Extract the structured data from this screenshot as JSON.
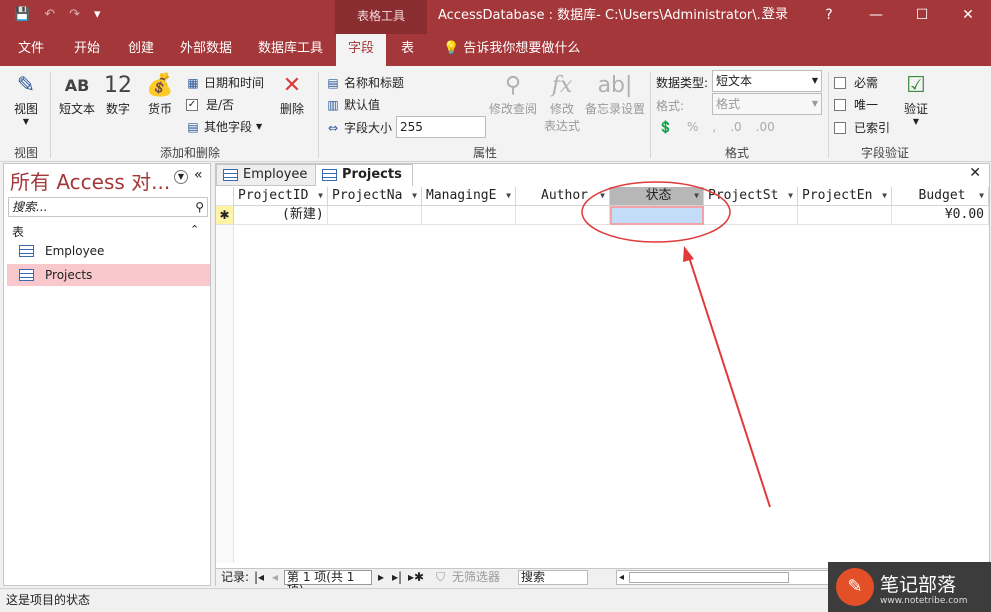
{
  "titlebar": {
    "qat": [
      "💾",
      "↶",
      "↷",
      "▾"
    ],
    "context_tools": "表格工具",
    "title": "AccessDatabase : 数据库- C:\\Users\\Administrator\\...",
    "login": "登录",
    "help": "?",
    "minimize": "—",
    "maximize": "☐",
    "close": "✕"
  },
  "tabs": {
    "file": "文件",
    "home": "开始",
    "create": "创建",
    "external": "外部数据",
    "dbtools": "数据库工具",
    "fields": "字段",
    "table": "表",
    "tellme": "告诉我你想要做什么"
  },
  "ribbon": {
    "view": "视图",
    "view_group": "视图",
    "short_text_icon": "AB",
    "short_text": "短文本",
    "number_icon": "12",
    "number": "数字",
    "currency": "货币",
    "datetime": "日期和时间",
    "yesno": "是/否",
    "more_fields": "其他字段",
    "delete": "删除",
    "add_delete_group": "添加和删除",
    "name_caption": "名称和标题",
    "default_value": "默认值",
    "field_size": "字段大小",
    "field_size_value": "255",
    "modify_lookups": "修改查阅",
    "modify_expr_1": "修改",
    "modify_expr_2": "表达式",
    "memo_settings": "备忘录设置",
    "properties_group": "属性",
    "data_type_label": "数据类型:",
    "data_type_value": "短文本",
    "format_label": "格式:",
    "format_value": "格式",
    "format_group": "格式",
    "required": "必需",
    "unique": "唯一",
    "indexed": "已索引",
    "validation": "验证",
    "validation_group": "字段验证"
  },
  "nav": {
    "title": "所有 Access 对...",
    "search_placeholder": "搜索...",
    "section": "表",
    "items": [
      "Employee",
      "Projects"
    ]
  },
  "doc": {
    "tabs": [
      "Employee",
      "Projects"
    ],
    "columns": [
      "ProjectID",
      "ProjectNa",
      "ManagingE",
      "Author",
      "状态",
      "ProjectSt",
      "ProjectEn",
      "Budget"
    ],
    "new_row_marker": "✱",
    "new_row_id": "(新建)",
    "new_row_budget": "¥0.00"
  },
  "recnav": {
    "label": "记录:",
    "position": "第 1 项(共 1 项)",
    "filter": "无筛选器",
    "search": "搜索"
  },
  "status": {
    "text": "这是项目的状态"
  },
  "watermark": {
    "title": "笔记部落",
    "url": "www.notetribe.com"
  },
  "colors": {
    "brand": "#a4373a",
    "selection": "#c3dcf7",
    "annotation": "#e03a3a"
  }
}
